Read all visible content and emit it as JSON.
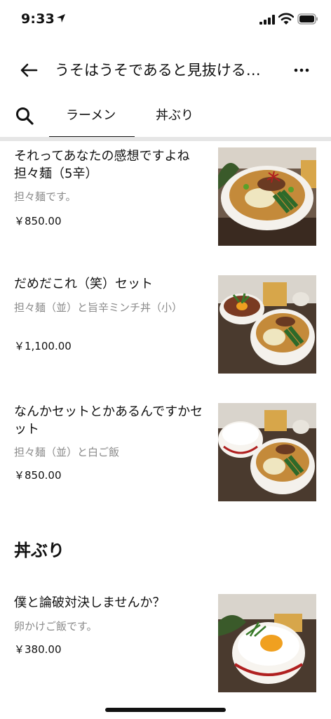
{
  "status_bar": {
    "time": "9:33"
  },
  "header": {
    "title": "うそはうそであると見抜ける…"
  },
  "tabs": [
    {
      "label": "ラーメン",
      "active": true
    },
    {
      "label": "丼ぶり",
      "active": false
    }
  ],
  "items": [
    {
      "name": "それってあなたの感想ですよね担々麺（5辛）",
      "description": "担々麺です。",
      "price": "￥850.00"
    },
    {
      "name": "だめだこれ（笑）セット",
      "description": "担々麺（並）と旨辛ミンチ丼（小）",
      "price": "￥1,100.00"
    },
    {
      "name": "なんかセットとかあるんですかセット",
      "description": "担々麺（並）と白ご飯",
      "price": "￥850.00"
    }
  ],
  "section": {
    "title": "丼ぶり"
  },
  "don_items": [
    {
      "name": "僕と論破対決しませんか？",
      "description": "卵かけご飯です。",
      "price": "￥380.00"
    }
  ],
  "colors": {
    "text": "#111111",
    "muted": "#8a8a8a",
    "divider": "#e6e6e6"
  },
  "icons": [
    "location-arrow-icon",
    "signal-icon",
    "wifi-icon",
    "battery-icon",
    "back-arrow-icon",
    "more-icon",
    "search-icon"
  ]
}
